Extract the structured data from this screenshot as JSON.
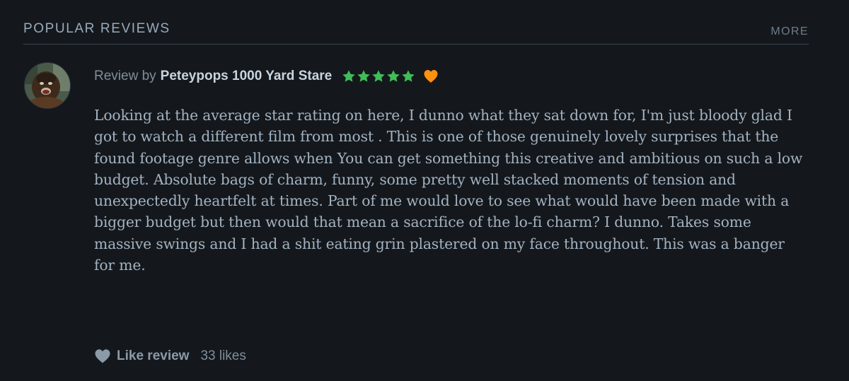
{
  "section": {
    "title": "POPULAR REVIEWS",
    "more_label": "MORE"
  },
  "review": {
    "byline_prefix": "Review by",
    "username": "Peteypops 1000 Yard Stare",
    "rating_stars": 5,
    "liked": true,
    "body": "Looking at the average star rating on here, I dunno what they sat down for, I'm just bloody glad I got to watch a different film from most . This is one of those genuinely lovely surprises that the found footage genre allows when You can get something this creative and ambitious on such a low budget. Absolute bags of charm, funny, some pretty well stacked moments of tension and unexpectedly heartfelt at times. Part of me would love to see what would have been made with a bigger budget but then would that mean a sacrifice of the lo-fi charm? I dunno. Takes some massive swings and I had a shit eating grin plastered on my face throughout. This was a banger for me.",
    "like_label": "Like review",
    "likes_count": "33 likes"
  },
  "colors": {
    "background": "#14181c",
    "star": "#40bc59",
    "heart_liked": "#ff9010",
    "like_icon": "#8a9aa8"
  }
}
